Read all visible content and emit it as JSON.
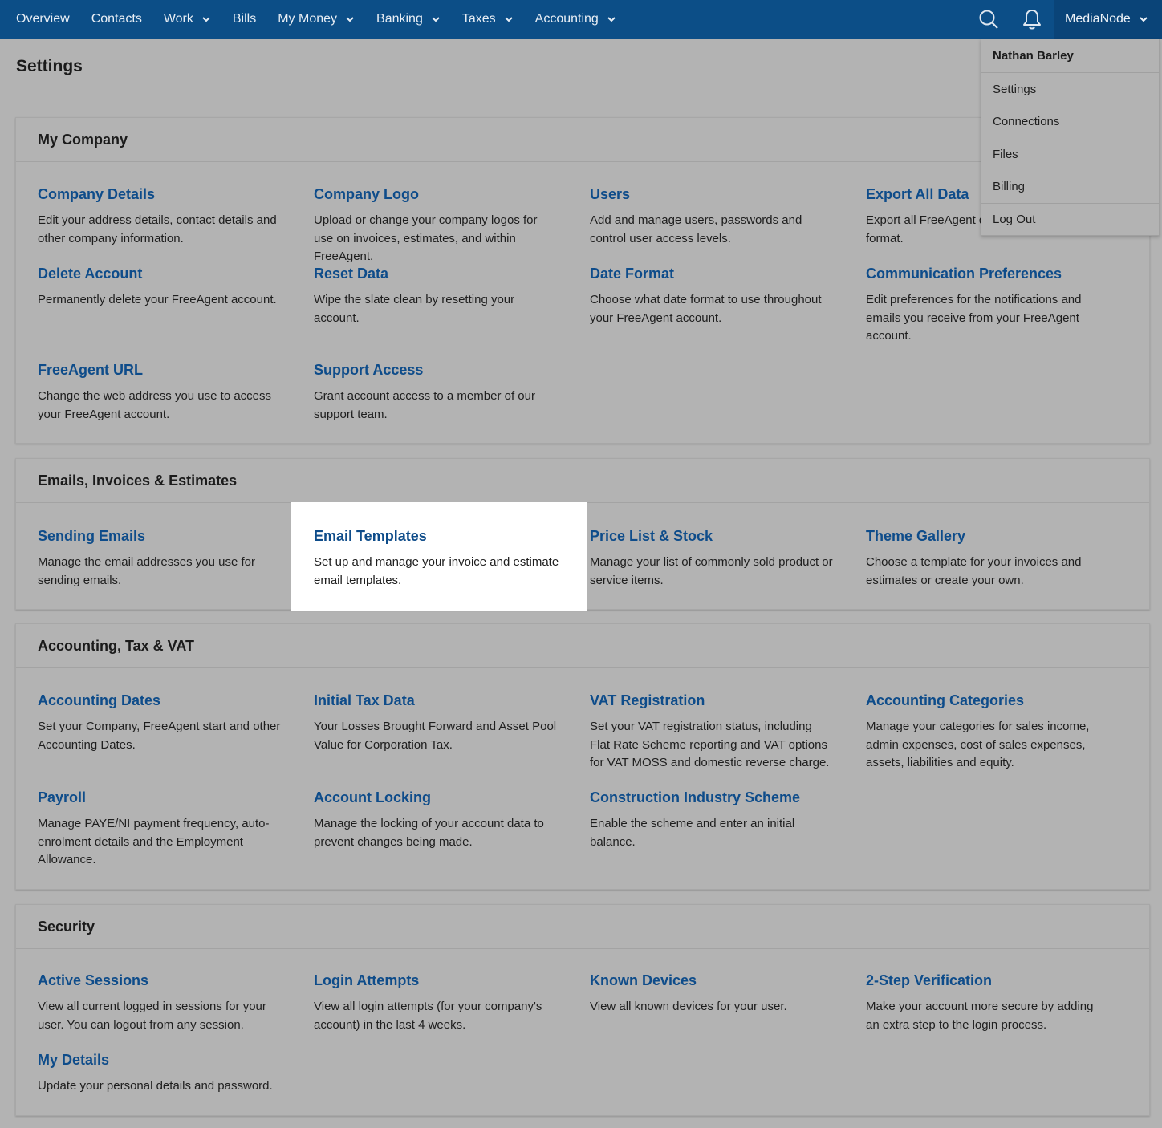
{
  "nav": {
    "items": [
      {
        "label": "Overview",
        "has_dropdown": false
      },
      {
        "label": "Contacts",
        "has_dropdown": false
      },
      {
        "label": "Work",
        "has_dropdown": true
      },
      {
        "label": "Bills",
        "has_dropdown": false
      },
      {
        "label": "My Money",
        "has_dropdown": true
      },
      {
        "label": "Banking",
        "has_dropdown": true
      },
      {
        "label": "Taxes",
        "has_dropdown": true
      },
      {
        "label": "Accounting",
        "has_dropdown": true
      }
    ],
    "icons": [
      "search-icon",
      "bell-icon"
    ],
    "account_label": "MediaNode"
  },
  "page": {
    "title": "Settings"
  },
  "account_menu": {
    "user_name": "Nathan Barley",
    "items": [
      "Settings",
      "Connections",
      "Files",
      "Billing",
      "Log Out"
    ]
  },
  "sections": [
    {
      "title": "My Company",
      "items": [
        {
          "title": "Company Details",
          "desc": "Edit your address details, contact details and other company information."
        },
        {
          "title": "Company Logo",
          "desc": "Upload or change your company logos for use on invoices, estimates, and within FreeAgent."
        },
        {
          "title": "Users",
          "desc": "Add and manage users, passwords and control user access levels."
        },
        {
          "title": "Export All Data",
          "desc": "Export all FreeAgent data in Excel (XLSX) format."
        },
        {
          "title": "Delete Account",
          "desc": "Permanently delete your FreeAgent account."
        },
        {
          "title": "Reset Data",
          "desc": "Wipe the slate clean by resetting your account."
        },
        {
          "title": "Date Format",
          "desc": "Choose what date format to use throughout your FreeAgent account."
        },
        {
          "title": "Communication Preferences",
          "desc": "Edit preferences for the notifications and emails you receive from your FreeAgent account."
        },
        {
          "title": "FreeAgent URL",
          "desc": "Change the web address you use to access your FreeAgent account."
        },
        {
          "title": "Support Access",
          "desc": "Grant account access to a member of our support team."
        }
      ]
    },
    {
      "title": "Emails, Invoices & Estimates",
      "items": [
        {
          "title": "Sending Emails",
          "desc": "Manage the email addresses you use for sending emails."
        },
        {
          "title": "Email Templates",
          "desc": "Set up and manage your invoice and estimate email templates.",
          "highlighted": true
        },
        {
          "title": "Price List & Stock",
          "desc": "Manage your list of commonly sold product or service items."
        },
        {
          "title": "Theme Gallery",
          "desc": "Choose a template for your invoices and estimates or create your own."
        }
      ]
    },
    {
      "title": "Accounting, Tax & VAT",
      "items": [
        {
          "title": "Accounting Dates",
          "desc": "Set your Company, FreeAgent start and other Accounting Dates."
        },
        {
          "title": "Initial Tax Data",
          "desc": "Your Losses Brought Forward and Asset Pool Value for Corporation Tax."
        },
        {
          "title": "VAT Registration",
          "desc": "Set your VAT registration status, including Flat Rate Scheme reporting and VAT options for VAT MOSS and domestic reverse charge."
        },
        {
          "title": "Accounting Categories",
          "desc": "Manage your categories for sales income, admin expenses, cost of sales expenses, assets, liabilities and equity."
        },
        {
          "title": "Payroll",
          "desc": "Manage PAYE/NI payment frequency, auto-enrolment details and the Employment Allowance."
        },
        {
          "title": "Account Locking",
          "desc": "Manage the locking of your account data to prevent changes being made."
        },
        {
          "title": "Construction Industry Scheme",
          "desc": "Enable the scheme and enter an initial balance."
        }
      ]
    },
    {
      "title": "Security",
      "items": [
        {
          "title": "Active Sessions",
          "desc": "View all current logged in sessions for your user. You can logout from any session."
        },
        {
          "title": "Login Attempts",
          "desc": "View all login attempts (for your company's account) in the last 4 weeks."
        },
        {
          "title": "Known Devices",
          "desc": "View all known devices for your user."
        },
        {
          "title": "2-Step Verification",
          "desc": "Make your account more secure by adding an extra step to the login process."
        },
        {
          "title": "My Details",
          "desc": "Update your personal details and password."
        }
      ]
    }
  ]
}
